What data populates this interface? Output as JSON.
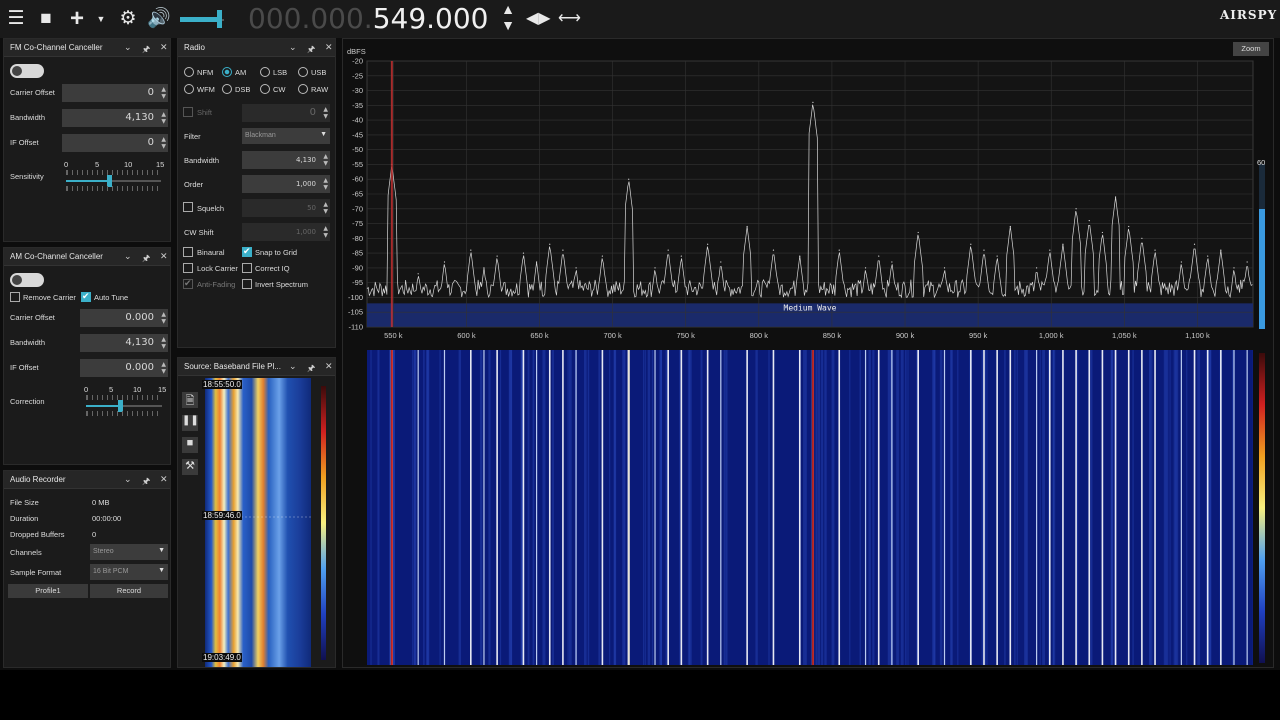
{
  "toolbar": {
    "freq_dim": "000.000.",
    "freq_hi": "549.000",
    "brand": "AIRSPY",
    "menu_icon": "menu-icon",
    "stop_icon": "stop-icon",
    "add_icon": "add-icon",
    "settings_icon": "gear-icon",
    "volume_icon": "speaker-icon"
  },
  "fm_canceller": {
    "title": "FM Co-Channel Canceller",
    "carrier_offset_label": "Carrier Offset",
    "carrier_offset": "0",
    "bandwidth_label": "Bandwidth",
    "bandwidth": "4,130",
    "if_offset_label": "IF Offset",
    "if_offset": "0",
    "sensitivity_label": "Sensitivity",
    "scale": [
      "0",
      "5",
      "10",
      "15"
    ]
  },
  "am_canceller": {
    "title": "AM Co-Channel Canceller",
    "remove_carrier": "Remove Carrier",
    "auto_tune": "Auto Tune",
    "carrier_offset_label": "Carrier Offset",
    "carrier_offset": "0.000",
    "bandwidth_label": "Bandwidth",
    "bandwidth": "4,130",
    "if_offset_label": "IF Offset",
    "if_offset": "0.000",
    "correction_label": "Correction",
    "scale": [
      "0",
      "5",
      "10",
      "15"
    ]
  },
  "audio_recorder": {
    "title": "Audio Recorder",
    "file_size_label": "File Size",
    "file_size": "0 MB",
    "duration_label": "Duration",
    "duration": "00:00:00",
    "dropped_label": "Dropped Buffers",
    "dropped": "0",
    "channels_label": "Channels",
    "channels": "Stereo",
    "format_label": "Sample Format",
    "format": "16 Bit PCM",
    "profile_button": "Profile1",
    "record_button": "Record"
  },
  "radio": {
    "title": "Radio",
    "modes": [
      "NFM",
      "AM",
      "LSB",
      "USB",
      "WFM",
      "DSB",
      "CW",
      "RAW"
    ],
    "selected_mode": "AM",
    "shift_label": "Shift",
    "shift": "0",
    "filter_label": "Filter",
    "filter": "Blackman",
    "bandwidth_label": "Bandwidth",
    "bandwidth": "4,130",
    "order_label": "Order",
    "order": "1,000",
    "squelch_label": "Squelch",
    "squelch": "50",
    "cw_shift_label": "CW Shift",
    "cw_shift": "1,000",
    "binaural": "Binaural",
    "snap_to_grid": "Snap to Grid",
    "lock_carrier": "Lock Carrier",
    "correct_iq": "Correct IQ",
    "anti_fading": "Anti-Fading",
    "invert_spectrum": "Invert Spectrum"
  },
  "source": {
    "title": "Source: Baseband File Pl...",
    "times": [
      "18:55:50.0",
      "18:59:46.0",
      "19:03:49.0"
    ]
  },
  "spectrum": {
    "zoom_button": "Zoom",
    "unit": "dBFS",
    "band_label": "Medium Wave",
    "level_value": "60",
    "level_fraction": 0.73,
    "volume_fraction": 0.9
  },
  "chart_data": {
    "type": "line",
    "title": "",
    "xlabel": "",
    "ylabel": "dBFS",
    "xlim": [
      532,
      1138
    ],
    "ylim": [
      -110,
      -20
    ],
    "y_ticks": [
      "-20",
      "-25",
      "-30",
      "-35",
      "-40",
      "-45",
      "-50",
      "-55",
      "-60",
      "-65",
      "-70",
      "-75",
      "-80",
      "-85",
      "-90",
      "-95",
      "-100",
      "-105",
      "-110"
    ],
    "x_ticks": [
      "550 k",
      "600 k",
      "650 k",
      "700 k",
      "750 k",
      "800 k",
      "850 k",
      "900 k",
      "950 k",
      "1,000 k",
      "1,050 k",
      "1,100 k"
    ],
    "tuned_khz": 549,
    "peaks_khz": [
      549,
      567,
      585,
      603,
      612,
      621,
      639,
      648,
      657,
      666,
      675,
      693,
      711,
      729,
      738,
      747,
      765,
      774,
      792,
      810,
      828,
      837,
      855,
      873,
      882,
      891,
      909,
      927,
      945,
      954,
      963,
      972,
      990,
      999,
      1008,
      1017,
      1026,
      1035,
      1044,
      1053,
      1062,
      1071,
      1089,
      1098,
      1107,
      1116,
      1125,
      1134
    ],
    "peaks_dbfs": [
      -55,
      -92,
      -88,
      -84,
      -90,
      -86,
      -85,
      -88,
      -82,
      -84,
      -90,
      -86,
      -60,
      -90,
      -84,
      -86,
      -82,
      -88,
      -76,
      -84,
      -86,
      -34,
      -84,
      -90,
      -86,
      -88,
      -78,
      -90,
      -82,
      -84,
      -86,
      -76,
      -90,
      -84,
      -82,
      -70,
      -74,
      -78,
      -66,
      -76,
      -80,
      -84,
      -88,
      -82,
      -86,
      -84,
      -90,
      -88
    ],
    "noise_floor_dbfs": -97
  }
}
